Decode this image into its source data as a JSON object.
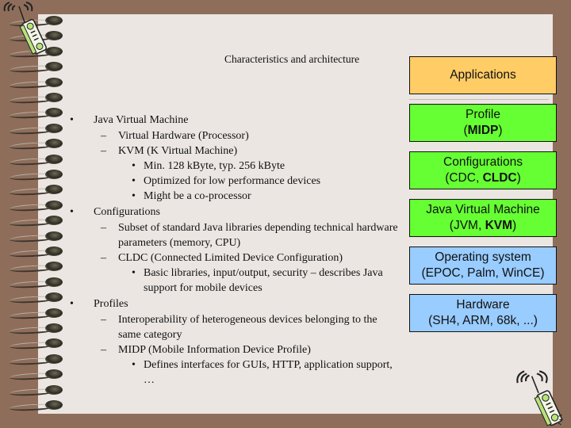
{
  "slide": {
    "title": "Characteristics and architecture",
    "bullets": [
      {
        "level": 1,
        "marker": "•",
        "text": "Java Virtual Machine"
      },
      {
        "level": 2,
        "marker": "–",
        "text": "Virtual Hardware (Processor)"
      },
      {
        "level": 2,
        "marker": "–",
        "text": "KVM (K Virtual Machine)"
      },
      {
        "level": 3,
        "marker": "•",
        "text": "Min. 128 kByte, typ. 256 kByte"
      },
      {
        "level": 3,
        "marker": "•",
        "text": "Optimized for low performance devices"
      },
      {
        "level": 3,
        "marker": "•",
        "text": "Might be a co-processor"
      },
      {
        "level": 1,
        "marker": "•",
        "text": "Configurations"
      },
      {
        "level": 2,
        "marker": "–",
        "text": "Subset of standard Java libraries depending technical hardware parameters (memory, CPU)"
      },
      {
        "level": 2,
        "marker": "–",
        "text": "CLDC (Connected Limited Device Configuration)"
      },
      {
        "level": 3,
        "marker": "•",
        "text": "Basic libraries, input/output, security – describes Java support for mobile devices"
      },
      {
        "level": 1,
        "marker": "•",
        "text": "Profiles"
      },
      {
        "level": 2,
        "marker": "–",
        "text": "Interoperability of heterogeneous devices belonging to the same category"
      },
      {
        "level": 2,
        "marker": "–",
        "text": "MIDP (Mobile Information Device Profile)"
      },
      {
        "level": 3,
        "marker": "•",
        "text": "Defines interfaces for GUIs, HTTP, application support, …"
      }
    ],
    "architecture": [
      {
        "line1": "Applications",
        "line2_pre": "",
        "line2_bold": "",
        "line2_post": "",
        "color": "#ffcc66"
      },
      {
        "line1": "Profile",
        "line2_pre": "(",
        "line2_bold": "MIDP",
        "line2_post": ")",
        "color": "#66ff33"
      },
      {
        "line1": "Configurations",
        "line2_pre": "(CDC, ",
        "line2_bold": "CLDC",
        "line2_post": ")",
        "color": "#66ff33"
      },
      {
        "line1": "Java Virtual Machine",
        "line2_pre": "(JVM, ",
        "line2_bold": "KVM",
        "line2_post": ")",
        "color": "#66ff33"
      },
      {
        "line1": "Operating system",
        "line2_pre": "(EPOC, Palm, WinCE)",
        "line2_bold": "",
        "line2_post": "",
        "color": "#99ccff"
      },
      {
        "line1": "Hardware",
        "line2_pre": "(SH4, ARM, 68k, ...)",
        "line2_bold": "",
        "line2_post": "",
        "color": "#99ccff"
      }
    ]
  }
}
